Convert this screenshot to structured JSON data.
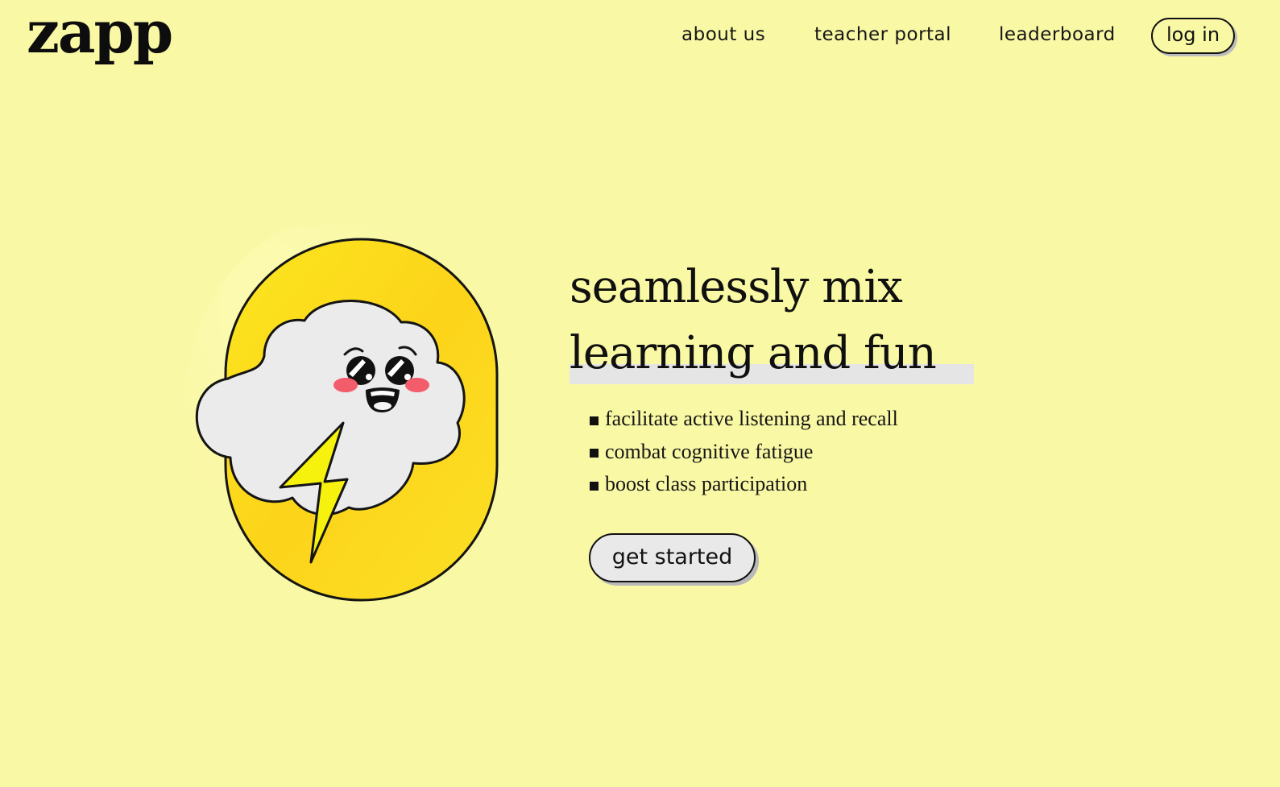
{
  "brand": {
    "logo_text": "zapp"
  },
  "nav": {
    "links": [
      {
        "label": "about us"
      },
      {
        "label": "teacher portal"
      },
      {
        "label": "leaderboard"
      }
    ],
    "login_label": "log in"
  },
  "hero": {
    "headline": "seamlessly mix learning and fun",
    "features": [
      "facilitate active listening and recall",
      "combat cognitive fatigue",
      "boost class participation"
    ],
    "cta_label": "get started"
  },
  "colors": {
    "background": "#f9f8a4",
    "oval_yellow": "#fcd819",
    "cloud": "#ebebeb",
    "blush": "#f25c6b",
    "bolt": "#f6f20e",
    "button_fill": "#e9e9e9"
  }
}
